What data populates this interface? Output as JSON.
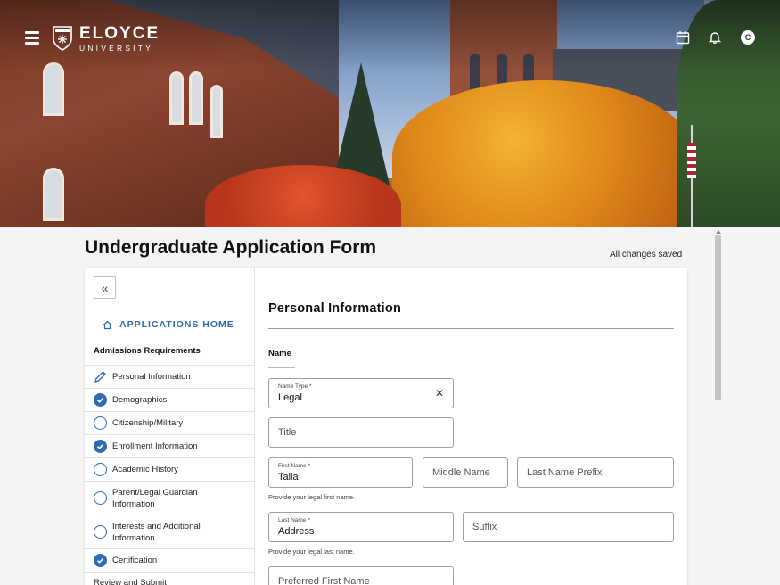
{
  "header": {
    "brand_name": "ELOYCE",
    "brand_sub": "UNIVERSITY",
    "avatar_initial": "C",
    "icons": [
      "menu-icon",
      "calendar-icon",
      "bell-icon",
      "avatar"
    ]
  },
  "page": {
    "title": "Undergraduate Application Form",
    "save_status": "All changes saved"
  },
  "sidebar": {
    "collapse_glyph": "«",
    "home_label": "APPLICATIONS HOME",
    "section_title": "Admissions Requirements",
    "items": [
      {
        "label": "Personal Information",
        "status": "editing"
      },
      {
        "label": "Demographics",
        "status": "complete"
      },
      {
        "label": "Citizenship/Military",
        "status": "incomplete"
      },
      {
        "label": "Enrollment Information",
        "status": "complete"
      },
      {
        "label": "Academic History",
        "status": "incomplete"
      },
      {
        "label": "Parent/Legal Guardian Information",
        "status": "incomplete"
      },
      {
        "label": "Interests and Additional Information",
        "status": "incomplete"
      },
      {
        "label": "Certification",
        "status": "complete"
      },
      {
        "label": "Review and Submit",
        "status": "none"
      }
    ]
  },
  "form": {
    "section_title": "Personal Information",
    "group_title": "Name",
    "name_type": {
      "label": "Name Type *",
      "value": "Legal",
      "clear": "✕"
    },
    "title": {
      "placeholder": "Title"
    },
    "first_name": {
      "label": "First Name *",
      "value": "Talia",
      "hint": "Provide your legal first name."
    },
    "middle_name": {
      "placeholder": "Middle Name"
    },
    "last_name_prefix": {
      "placeholder": "Last Name Prefix"
    },
    "last_name": {
      "label": "Last Name *",
      "value": "Address",
      "hint": "Provide your legal last name."
    },
    "suffix": {
      "placeholder": "Suffix"
    },
    "preferred_first_name": {
      "placeholder": "Preferred First Name"
    }
  },
  "colors": {
    "accent": "#2f6bb3",
    "link": "#2b6cb0"
  }
}
